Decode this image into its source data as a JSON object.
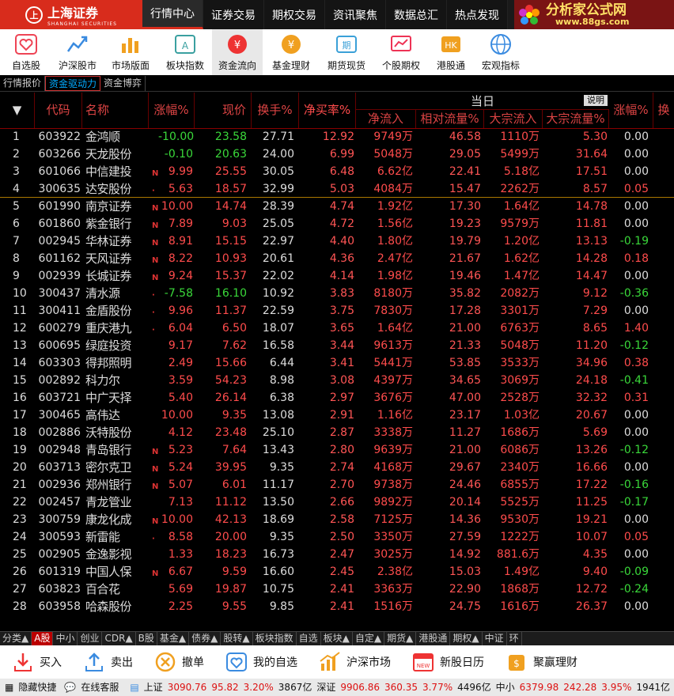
{
  "app": {
    "logo_text": "上海证券",
    "logo_sub": "SHANGHAI SECURITIES",
    "logo_mark": "上"
  },
  "topnav": [
    "行情中心",
    "证券交易",
    "期权交易",
    "资讯聚焦",
    "数据总汇",
    "热点发现"
  ],
  "brand": {
    "title": "分析家公式网",
    "url": "www.88gs.com"
  },
  "toolbar": [
    {
      "label": "自选股",
      "icon": "heart-icon",
      "color": "#e45"
    },
    {
      "label": "沪深股市",
      "icon": "line-chart-icon",
      "color": "#3a8be0"
    },
    {
      "label": "市场版面",
      "icon": "bar-chart-icon",
      "color": "#f0a020"
    },
    {
      "label": "板块指数",
      "icon": "index-icon",
      "color": "#3aa0a0"
    },
    {
      "label": "资金流向",
      "icon": "money-icon",
      "color": "#e33"
    },
    {
      "label": "基金理财",
      "icon": "fund-icon",
      "color": "#f0a020"
    },
    {
      "label": "期货现货",
      "icon": "futures-icon",
      "color": "#3aa0d8"
    },
    {
      "label": "个股期权",
      "icon": "option-icon",
      "color": "#e35"
    },
    {
      "label": "港股通",
      "icon": "hk-icon",
      "color": "#f0a020"
    },
    {
      "label": "宏观指标",
      "icon": "globe-icon",
      "color": "#3a8be0"
    }
  ],
  "subtabs": [
    "行情报价",
    "资金驱动力",
    "资金博弈"
  ],
  "header": {
    "group_label": "当日",
    "explain_btn": "说明",
    "cols": [
      "代码",
      "名称",
      "涨幅%",
      "现价",
      "换手%",
      "净买率%",
      "净流入",
      "相对流量%",
      "大宗流入",
      "大宗流量%",
      "涨幅%",
      "换"
    ]
  },
  "rows": [
    {
      "n": "1",
      "code": "603922",
      "name": "金鸿顺",
      "mark": "",
      "pct": "-10.00",
      "price": "23.58",
      "turn": "27.71",
      "netr": "12.92",
      "netf": "9749万",
      "relf": "46.58",
      "bigf": "1110万",
      "bigr": "5.30",
      "chg2": "0.00"
    },
    {
      "n": "2",
      "code": "603266",
      "name": "天龙股份",
      "mark": "",
      "pct": "-0.10",
      "price": "20.63",
      "turn": "24.00",
      "netr": "6.99",
      "netf": "5048万",
      "relf": "29.05",
      "bigf": "5499万",
      "bigr": "31.64",
      "chg2": "0.00"
    },
    {
      "n": "3",
      "code": "601066",
      "name": "中信建投",
      "mark": "N",
      "pct": "9.99",
      "price": "25.55",
      "turn": "30.05",
      "netr": "6.48",
      "netf": "6.62亿",
      "relf": "22.41",
      "bigf": "5.18亿",
      "bigr": "17.51",
      "chg2": "0.00"
    },
    {
      "n": "4",
      "code": "300635",
      "name": "达安股份",
      "mark": "·",
      "pct": "5.63",
      "price": "18.57",
      "turn": "32.99",
      "netr": "5.03",
      "netf": "4084万",
      "relf": "15.47",
      "bigf": "2262万",
      "bigr": "8.57",
      "chg2": "0.05"
    },
    {
      "n": "5",
      "code": "601990",
      "name": "南京证券",
      "mark": "N",
      "pct": "10.00",
      "price": "14.74",
      "turn": "28.39",
      "netr": "4.74",
      "netf": "1.92亿",
      "relf": "17.30",
      "bigf": "1.64亿",
      "bigr": "14.78",
      "chg2": "0.00"
    },
    {
      "n": "6",
      "code": "601860",
      "name": "紫金银行",
      "mark": "N",
      "pct": "7.89",
      "price": "9.03",
      "turn": "25.05",
      "netr": "4.72",
      "netf": "1.56亿",
      "relf": "19.23",
      "bigf": "9579万",
      "bigr": "11.81",
      "chg2": "0.00"
    },
    {
      "n": "7",
      "code": "002945",
      "name": "华林证券",
      "mark": "N",
      "pct": "8.91",
      "price": "15.15",
      "turn": "22.97",
      "netr": "4.40",
      "netf": "1.80亿",
      "relf": "19.79",
      "bigf": "1.20亿",
      "bigr": "13.13",
      "chg2": "-0.19"
    },
    {
      "n": "8",
      "code": "601162",
      "name": "天风证券",
      "mark": "N",
      "pct": "8.22",
      "price": "10.93",
      "turn": "20.61",
      "netr": "4.36",
      "netf": "2.47亿",
      "relf": "21.67",
      "bigf": "1.62亿",
      "bigr": "14.28",
      "chg2": "0.18"
    },
    {
      "n": "9",
      "code": "002939",
      "name": "长城证券",
      "mark": "N",
      "pct": "9.24",
      "price": "15.37",
      "turn": "22.02",
      "netr": "4.14",
      "netf": "1.98亿",
      "relf": "19.46",
      "bigf": "1.47亿",
      "bigr": "14.47",
      "chg2": "0.00"
    },
    {
      "n": "10",
      "code": "300437",
      "name": "清水源",
      "mark": "·",
      "pct": "-7.58",
      "price": "16.10",
      "turn": "10.92",
      "netr": "3.83",
      "netf": "8180万",
      "relf": "35.82",
      "bigf": "2082万",
      "bigr": "9.12",
      "chg2": "-0.36"
    },
    {
      "n": "11",
      "code": "300411",
      "name": "金盾股份",
      "mark": "·",
      "pct": "9.96",
      "price": "11.37",
      "turn": "22.59",
      "netr": "3.75",
      "netf": "7830万",
      "relf": "17.28",
      "bigf": "3301万",
      "bigr": "7.29",
      "chg2": "0.00"
    },
    {
      "n": "12",
      "code": "600279",
      "name": "重庆港九",
      "mark": "·",
      "pct": "6.04",
      "price": "6.50",
      "turn": "18.07",
      "netr": "3.65",
      "netf": "1.64亿",
      "relf": "21.00",
      "bigf": "6763万",
      "bigr": "8.65",
      "chg2": "1.40"
    },
    {
      "n": "13",
      "code": "600695",
      "name": "绿庭投资",
      "mark": "",
      "pct": "9.17",
      "price": "7.62",
      "turn": "16.58",
      "netr": "3.44",
      "netf": "9613万",
      "relf": "21.33",
      "bigf": "5048万",
      "bigr": "11.20",
      "chg2": "-0.12"
    },
    {
      "n": "14",
      "code": "603303",
      "name": "得邦照明",
      "mark": "",
      "pct": "2.49",
      "price": "15.66",
      "turn": "6.44",
      "netr": "3.41",
      "netf": "5441万",
      "relf": "53.85",
      "bigf": "3533万",
      "bigr": "34.96",
      "chg2": "0.38"
    },
    {
      "n": "15",
      "code": "002892",
      "name": "科力尔",
      "mark": "",
      "pct": "3.59",
      "price": "54.23",
      "turn": "8.98",
      "netr": "3.08",
      "netf": "4397万",
      "relf": "34.65",
      "bigf": "3069万",
      "bigr": "24.18",
      "chg2": "-0.41"
    },
    {
      "n": "16",
      "code": "603721",
      "name": "中广天择",
      "mark": "",
      "pct": "5.40",
      "price": "26.14",
      "turn": "6.38",
      "netr": "2.97",
      "netf": "3676万",
      "relf": "47.00",
      "bigf": "2528万",
      "bigr": "32.32",
      "chg2": "0.31"
    },
    {
      "n": "17",
      "code": "300465",
      "name": "高伟达",
      "mark": "",
      "pct": "10.00",
      "price": "9.35",
      "turn": "13.08",
      "netr": "2.91",
      "netf": "1.16亿",
      "relf": "23.17",
      "bigf": "1.03亿",
      "bigr": "20.67",
      "chg2": "0.00"
    },
    {
      "n": "18",
      "code": "002886",
      "name": "沃特股份",
      "mark": "",
      "pct": "4.12",
      "price": "23.48",
      "turn": "25.10",
      "netr": "2.87",
      "netf": "3338万",
      "relf": "11.27",
      "bigf": "1686万",
      "bigr": "5.69",
      "chg2": "0.00"
    },
    {
      "n": "19",
      "code": "002948",
      "name": "青岛银行",
      "mark": "N",
      "pct": "5.23",
      "price": "7.64",
      "turn": "13.43",
      "netr": "2.80",
      "netf": "9639万",
      "relf": "21.00",
      "bigf": "6086万",
      "bigr": "13.26",
      "chg2": "-0.12"
    },
    {
      "n": "20",
      "code": "603713",
      "name": "密尔克卫",
      "mark": "N",
      "pct": "5.24",
      "price": "39.95",
      "turn": "9.35",
      "netr": "2.74",
      "netf": "4168万",
      "relf": "29.67",
      "bigf": "2340万",
      "bigr": "16.66",
      "chg2": "0.00"
    },
    {
      "n": "21",
      "code": "002936",
      "name": "郑州银行",
      "mark": "N",
      "pct": "5.07",
      "price": "6.01",
      "turn": "11.17",
      "netr": "2.70",
      "netf": "9738万",
      "relf": "24.46",
      "bigf": "6855万",
      "bigr": "17.22",
      "chg2": "-0.16"
    },
    {
      "n": "22",
      "code": "002457",
      "name": "青龙管业",
      "mark": "",
      "pct": "7.13",
      "price": "11.12",
      "turn": "13.50",
      "netr": "2.66",
      "netf": "9892万",
      "relf": "20.14",
      "bigf": "5525万",
      "bigr": "11.25",
      "chg2": "-0.17"
    },
    {
      "n": "23",
      "code": "300759",
      "name": "康龙化成",
      "mark": "N",
      "pct": "10.00",
      "price": "42.13",
      "turn": "18.69",
      "netr": "2.58",
      "netf": "7125万",
      "relf": "14.36",
      "bigf": "9530万",
      "bigr": "19.21",
      "chg2": "0.00"
    },
    {
      "n": "24",
      "code": "300593",
      "name": "新雷能",
      "mark": "·",
      "pct": "8.58",
      "price": "20.00",
      "turn": "9.35",
      "netr": "2.50",
      "netf": "3350万",
      "relf": "27.59",
      "bigf": "1222万",
      "bigr": "10.07",
      "chg2": "0.05"
    },
    {
      "n": "25",
      "code": "002905",
      "name": "金逸影视",
      "mark": "",
      "pct": "1.33",
      "price": "18.23",
      "turn": "16.73",
      "netr": "2.47",
      "netf": "3025万",
      "relf": "14.92",
      "bigf": "881.6万",
      "bigr": "4.35",
      "chg2": "0.00"
    },
    {
      "n": "26",
      "code": "601319",
      "name": "中国人保",
      "mark": "N",
      "pct": "6.67",
      "price": "9.59",
      "turn": "16.60",
      "netr": "2.45",
      "netf": "2.38亿",
      "relf": "15.03",
      "bigf": "1.49亿",
      "bigr": "9.40",
      "chg2": "-0.09"
    },
    {
      "n": "27",
      "code": "603823",
      "name": "百合花",
      "mark": "",
      "pct": "5.69",
      "price": "19.87",
      "turn": "10.75",
      "netr": "2.41",
      "netf": "3363万",
      "relf": "22.90",
      "bigf": "1868万",
      "bigr": "12.72",
      "chg2": "-0.24"
    },
    {
      "n": "28",
      "code": "603958",
      "name": "哈森股份",
      "mark": "",
      "pct": "2.25",
      "price": "9.55",
      "turn": "9.85",
      "netr": "2.41",
      "netf": "1516万",
      "relf": "24.75",
      "bigf": "1616万",
      "bigr": "26.37",
      "chg2": "0.00"
    }
  ],
  "bottom_tabs": [
    "分类▲",
    "A股",
    "中小",
    "创业",
    "CDR▲",
    "B股",
    "基金▲",
    "债券▲",
    "股转▲",
    "板块指数",
    "自选",
    "板块▲",
    "自定▲",
    "期货▲",
    "港股通",
    "期权▲",
    "中证",
    "环"
  ],
  "quick_actions": [
    {
      "label": "买入",
      "icon": "buy-icon"
    },
    {
      "label": "卖出",
      "icon": "sell-icon"
    },
    {
      "label": "撤单",
      "icon": "cancel-order-icon"
    },
    {
      "label": "我的自选",
      "icon": "favorites-icon"
    },
    {
      "label": "沪深市场",
      "icon": "market-icon"
    },
    {
      "label": "新股日历",
      "icon": "calendar-icon"
    },
    {
      "label": "聚赢理财",
      "icon": "wealth-icon"
    }
  ],
  "status": {
    "hide": "隐藏快捷",
    "service": "在线客服",
    "sh_label": "上证",
    "sh_val": "3090.76",
    "sh_chg": "95.82",
    "sh_pct": "3.20%",
    "sh_vol": "3867亿",
    "sz_label": "深证",
    "sz_val": "9906.86",
    "sz_chg": "360.35",
    "sz_pct": "3.77%",
    "sz_vol": "4496亿",
    "zx_label": "中小",
    "zx_val": "6379.98",
    "zx_chg": "242.28",
    "zx_pct": "3.95%",
    "zx_vol": "1941亿"
  }
}
